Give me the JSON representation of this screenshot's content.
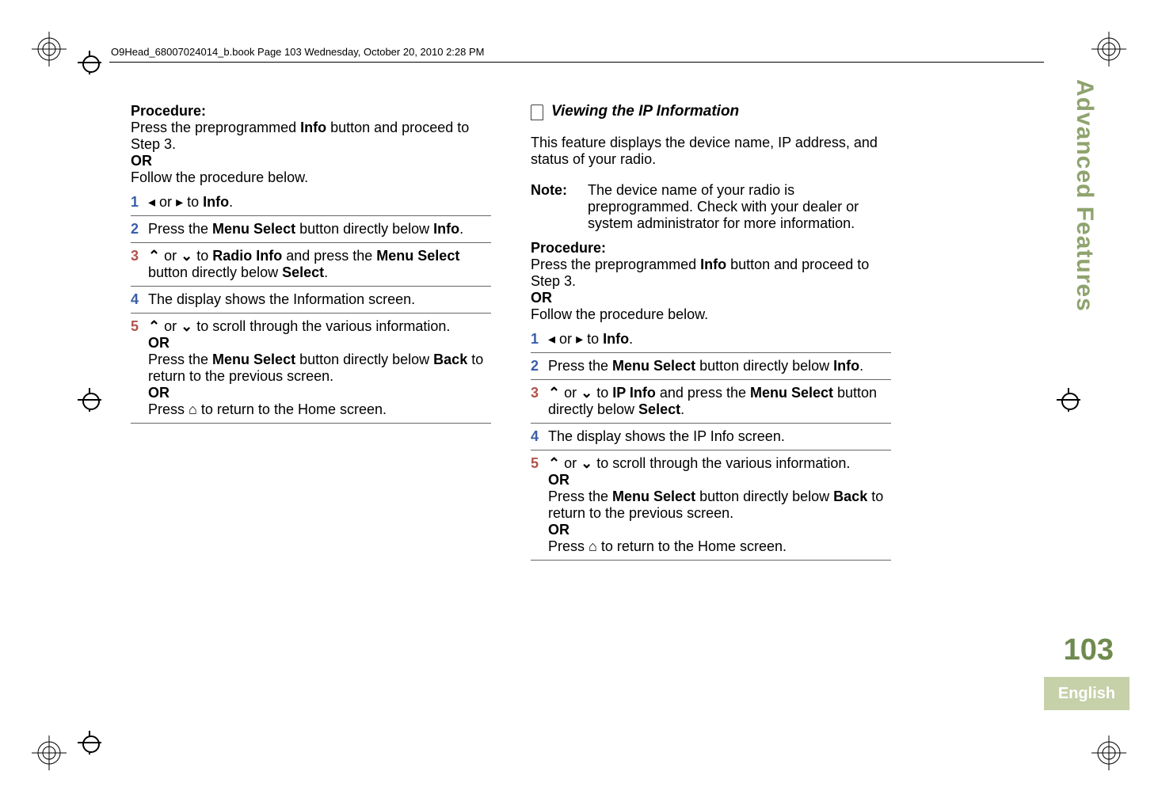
{
  "book_header": "O9Head_68007024014_b.book  Page 103  Wednesday, October 20, 2010  2:28 PM",
  "side_title": "Advanced Features",
  "page_number": "103",
  "language_label": "English",
  "left": {
    "proc_label": "Procedure:",
    "proc_line1a": "Press the preprogrammed ",
    "proc_line1b": "Info",
    "proc_line1c": " button and proceed to Step 3.",
    "or": "OR",
    "proc_line2": "Follow the procedure below.",
    "s1a": " or ",
    "s1b": " to ",
    "s1c": "Info",
    "s1d": ".",
    "s2a": "Press the ",
    "s2b": "Menu Select",
    "s2c": " button directly below ",
    "s2d": "Info",
    "s2e": ".",
    "s3a": " or ",
    "s3b": " to ",
    "s3c": "Radio Info",
    "s3d": " and press the ",
    "s3e": "Menu Select",
    "s3f": " button directly below ",
    "s3g": "Select",
    "s3h": ".",
    "s4": "The display shows the Information screen.",
    "s5a": " or ",
    "s5b": " to scroll through the various information.",
    "s5c": "OR",
    "s5d": "Press the ",
    "s5e": "Menu Select",
    "s5f": " button directly below ",
    "s5g": "Back",
    "s5h": " to return to the previous screen.",
    "s5i": "OR",
    "s5j": "Press ",
    "s5k": " to return to the Home screen."
  },
  "right": {
    "heading": "Viewing the IP Information",
    "intro": "This feature displays the device name, IP address, and status of your radio.",
    "note_label": "Note:",
    "note_body": "The device name of your radio is preprogrammed. Check with your dealer or system administrator for more information.",
    "proc_label": "Procedure:",
    "proc_line1a": "Press the preprogrammed ",
    "proc_line1b": "Info",
    "proc_line1c": " button and proceed to Step 3.",
    "or": "OR",
    "proc_line2": "Follow the procedure below.",
    "s1a": " or ",
    "s1b": " to ",
    "s1c": "Info",
    "s1d": ".",
    "s2a": "Press the ",
    "s2b": "Menu Select",
    "s2c": " button directly below ",
    "s2d": "Info",
    "s2e": ".",
    "s3a": " or ",
    "s3b": " to ",
    "s3c": "IP Info",
    "s3d": " and press the ",
    "s3e": "Menu Select",
    "s3f": " button directly below ",
    "s3g": "Select",
    "s3h": ".",
    "s4": "The display shows the IP Info screen.",
    "s5a": " or ",
    "s5b": " to scroll through the various information.",
    "s5c": "OR",
    "s5d": "Press the ",
    "s5e": "Menu Select",
    "s5f": " button directly below ",
    "s5g": "Back",
    "s5h": " to return to the previous screen.",
    "s5i": "OR",
    "s5j": "Press ",
    "s5k": " to return to the Home screen."
  }
}
